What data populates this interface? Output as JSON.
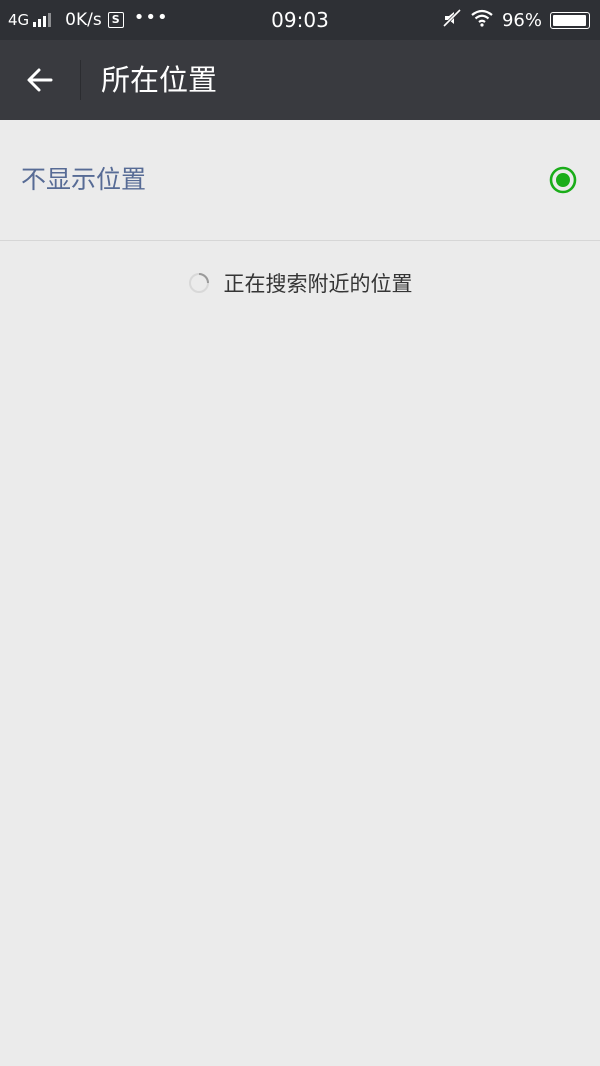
{
  "status_bar": {
    "network": "4G",
    "speed": "0K/s",
    "s_badge": "S",
    "more": "•••",
    "time": "09:03",
    "battery": "96%",
    "battery_level": 0.96
  },
  "nav": {
    "title": "所在位置"
  },
  "option": {
    "label": "不显示位置",
    "selected": true
  },
  "loading": {
    "text": "正在搜索附近的位置"
  },
  "colors": {
    "status_bg": "#2e3035",
    "nav_bg": "#393a3f",
    "page_bg": "#ebebeb",
    "link_blue": "#576b95",
    "accent_green": "#1aad19"
  }
}
